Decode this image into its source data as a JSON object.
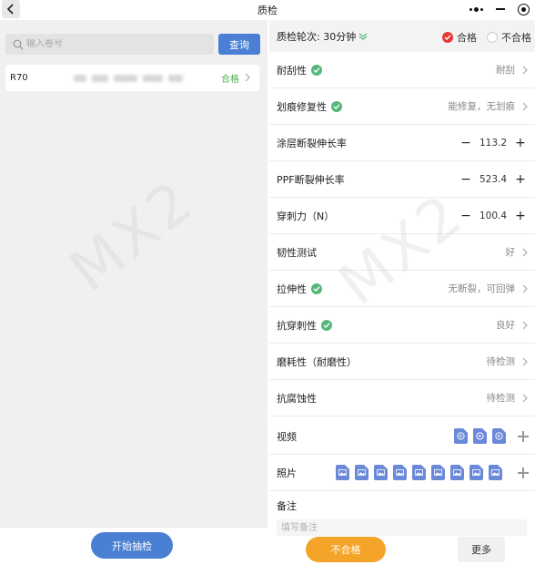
{
  "header": {
    "title": "质检"
  },
  "left": {
    "search_placeholder": "输入卷号",
    "query_label": "查询",
    "list": [
      {
        "code": "R70",
        "status": "合格"
      }
    ],
    "start_label": "开始抽检"
  },
  "watermark": "MX2",
  "right": {
    "round_label": "质检轮次: 30分钟",
    "pass_label": "合格",
    "fail_label": "不合格",
    "rows": [
      {
        "label": "耐刮性",
        "checked": true,
        "value": "耐刮"
      },
      {
        "label": "划痕修复性",
        "checked": true,
        "value": "能修复，无划痕"
      },
      {
        "label": "涂层断裂伸长率",
        "stepper": "113.2"
      },
      {
        "label": "PPF断裂伸长率",
        "stepper": "523.4"
      },
      {
        "label": "穿刺力（N）",
        "stepper": "100.4"
      },
      {
        "label": "韧性测试",
        "checked": true,
        "value": "好"
      },
      {
        "label": "拉伸性",
        "checked": true,
        "value": "无断裂，可回弹"
      },
      {
        "label": "抗穿刺性",
        "checked": true,
        "value": "良好"
      },
      {
        "label": "磨耗性（耐磨性）",
        "value": "待检测"
      },
      {
        "label": "抗腐蚀性",
        "value": "待检测"
      }
    ],
    "video_label": "视频",
    "video_count": 3,
    "photo_label": "照片",
    "photo_count": 9,
    "note_label": "备注",
    "note_placeholder": "填写备注",
    "fail_button": "不合格",
    "more_button": "更多"
  },
  "colors": {
    "primary": "#4a7fd4",
    "pass": "#4caf50",
    "check": "#54b87a",
    "radio_selected": "#e53935",
    "fail_button": "#f5a42a",
    "media": "#6b89d9"
  }
}
